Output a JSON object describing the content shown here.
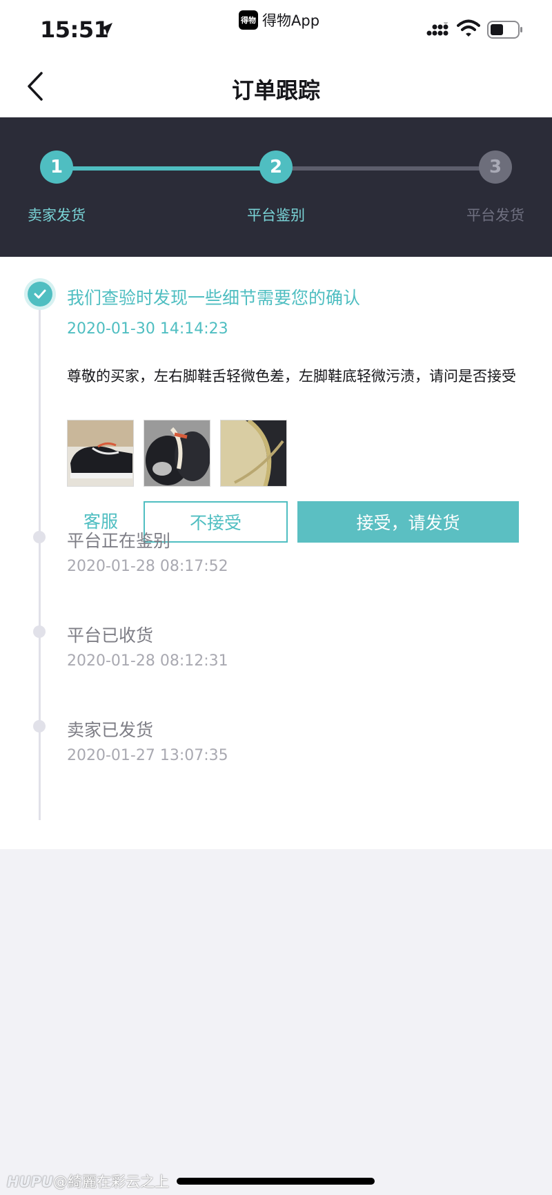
{
  "status_bar": {
    "time": "15:51",
    "back_app_logo": "得物",
    "back_app_label": "得物App",
    "icons": [
      "location-arrow-icon",
      "signal-icon",
      "wifi-icon",
      "battery-icon"
    ]
  },
  "nav": {
    "title": "订单跟踪",
    "back_icon": "chevron-left-icon"
  },
  "stepper": {
    "progress_current_step": 2,
    "steps": [
      {
        "number": "1",
        "label": "卖家发货",
        "state": "done"
      },
      {
        "number": "2",
        "label": "平台鉴别",
        "state": "current"
      },
      {
        "number": "3",
        "label": "平台发货",
        "state": "pending"
      }
    ]
  },
  "timeline": {
    "current": {
      "title": "我们查验时发现一些细节需要您的确认",
      "time": "2020-01-30 14:14:23",
      "description": "尊敬的买家，左右脚鞋舌轻微色差，左脚鞋底轻微污渍，请问是否接受",
      "photo_count": 3,
      "buttons": {
        "service": "客服",
        "reject": "不接受",
        "accept": "接受，请发货"
      }
    },
    "events": [
      {
        "title": "平台正在鉴别",
        "time": "2020-01-28 08:17:52"
      },
      {
        "title": "平台已收货",
        "time": "2020-01-28 08:12:31"
      },
      {
        "title": "卖家已发货",
        "time": "2020-01-27 13:07:35"
      }
    ]
  },
  "watermark": {
    "brand": "HUPU",
    "text": "@綺麗在彩云之上"
  },
  "colors": {
    "accent": "#4fbec1",
    "stepper_bg": "#2b2c38",
    "page_bg": "#f2f2f6"
  }
}
